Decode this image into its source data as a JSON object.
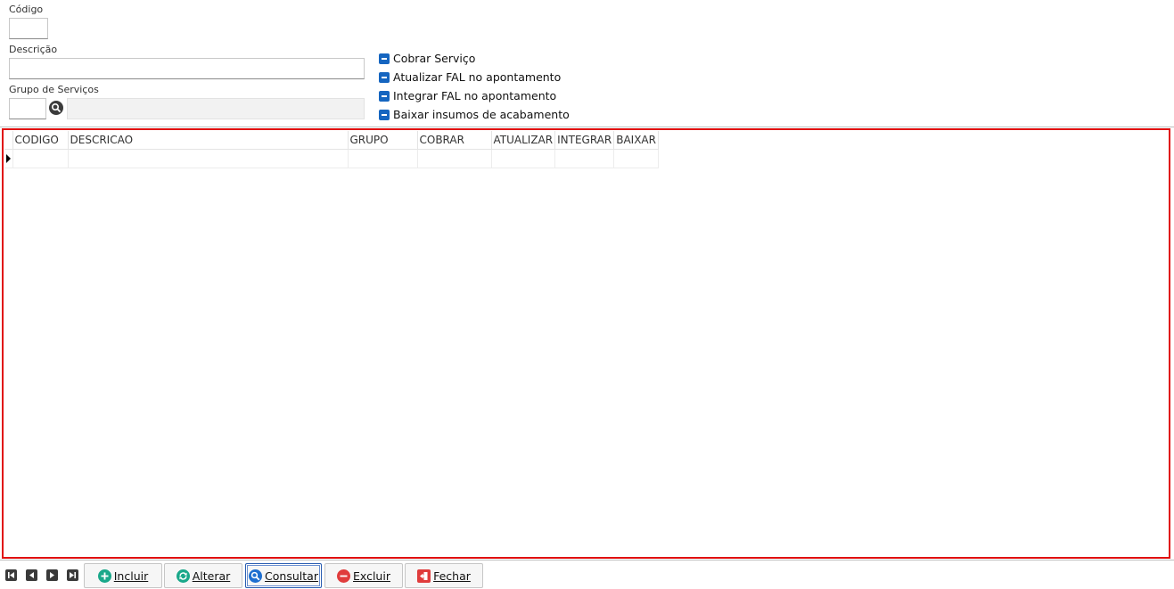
{
  "form": {
    "codigo_label": "Código",
    "codigo_value": "",
    "descricao_label": "Descrição",
    "descricao_value": "",
    "grupo_label": "Grupo de Serviços",
    "grupo_code_value": "",
    "grupo_desc_value": ""
  },
  "checkboxes": [
    {
      "label": "Cobrar Serviço",
      "state": "indeterminate"
    },
    {
      "label": "Atualizar FAL no apontamento",
      "state": "indeterminate"
    },
    {
      "label": "Integrar FAL no apontamento",
      "state": "indeterminate"
    },
    {
      "label": "Baixar insumos de acabamento",
      "state": "indeterminate"
    }
  ],
  "grid": {
    "columns": [
      "CODIGO",
      "DESCRICAO",
      "GRUPO",
      "COBRAR",
      "ATUALIZAR",
      "INTEGRAR",
      "BAIXAR"
    ],
    "rows": [
      [
        "",
        "",
        "",
        "",
        "",
        "",
        ""
      ]
    ]
  },
  "navigation": {
    "icons": [
      "first-record-icon",
      "prior-record-icon",
      "next-record-icon",
      "last-record-icon"
    ]
  },
  "buttons": {
    "incluir": "Incluir",
    "alterar": "Alterar",
    "consultar": "Consultar",
    "excluir": "Excluir",
    "fechar": "Fechar"
  },
  "colors": {
    "frame_border": "#e01010",
    "checkbox": "#1565c0",
    "incluir_icon": "#1aa88a",
    "alterar_icon": "#1aa88a",
    "consultar_icon": "#1e6fd0",
    "excluir_icon": "#e03c3c",
    "fechar_icon": "#e03c3c"
  }
}
